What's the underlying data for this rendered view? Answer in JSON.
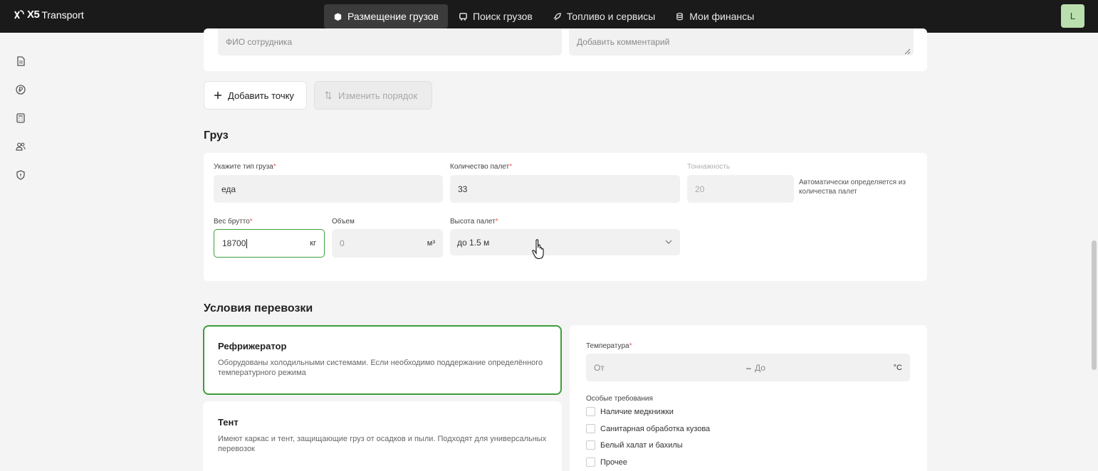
{
  "app": {
    "logo_mark": "X5",
    "logo_text": "Transport"
  },
  "nav": [
    {
      "label": "Размещение грузов",
      "icon": "box-icon",
      "active": true
    },
    {
      "label": "Поиск грузов",
      "icon": "truck-icon",
      "active": false
    },
    {
      "label": "Топливо и сервисы",
      "icon": "rocket-icon",
      "active": false
    },
    {
      "label": "Мои финансы",
      "icon": "coins-icon",
      "active": false
    }
  ],
  "user": {
    "avatar_letter": "L"
  },
  "sidebar": {
    "icons": [
      "document-icon",
      "ruble-icon",
      "calculator-icon",
      "users-icon",
      "shield-icon"
    ]
  },
  "top_card": {
    "employee_placeholder": "ФИО сотрудника",
    "comment_placeholder": "Добавить комментарий"
  },
  "actions": {
    "add_point": "Добавить точку",
    "change_order": "Изменить порядок"
  },
  "cargo": {
    "title": "Груз",
    "type_label": "Укажите тип груза",
    "type_value": "еда",
    "pallets_label": "Количество палет",
    "pallets_value": "33",
    "tonnage_label": "Тоннажность",
    "tonnage_value": "20",
    "tonnage_hint": "Автоматически определяется из количества палет",
    "weight_label": "Вес брутто",
    "weight_value": "18700",
    "weight_unit": "кг",
    "volume_label": "Объем",
    "volume_value": "0",
    "volume_unit": "м³",
    "height_label": "Высота палет",
    "height_value": "до 1.5 м",
    "required_mark": "*"
  },
  "conditions": {
    "title": "Условия перевозки",
    "options": [
      {
        "title": "Рефрижератор",
        "description": "Оборудованы холодильными системами. Если необходимо поддержание определённого температурного режима",
        "selected": true
      },
      {
        "title": "Тент",
        "description": "Имеют каркас и тент, защищающие груз от осадков и пыли. Подходят для универсальных перевозок",
        "selected": false
      }
    ],
    "temperature_label": "Температура",
    "temp_from_placeholder": "От",
    "temp_dash": "–",
    "temp_to_placeholder": "До",
    "temp_unit": "°C",
    "requirements_label": "Особые требования",
    "requirements": [
      "Наличие медкнижки",
      "Санитарная обработка кузова",
      "Белый халат и бахилы",
      "Прочее"
    ]
  },
  "colors": {
    "accent_green": "#3e9e3a",
    "topbar": "#1a1a1a",
    "avatar": "#b9dfae",
    "required": "#e55555"
  }
}
